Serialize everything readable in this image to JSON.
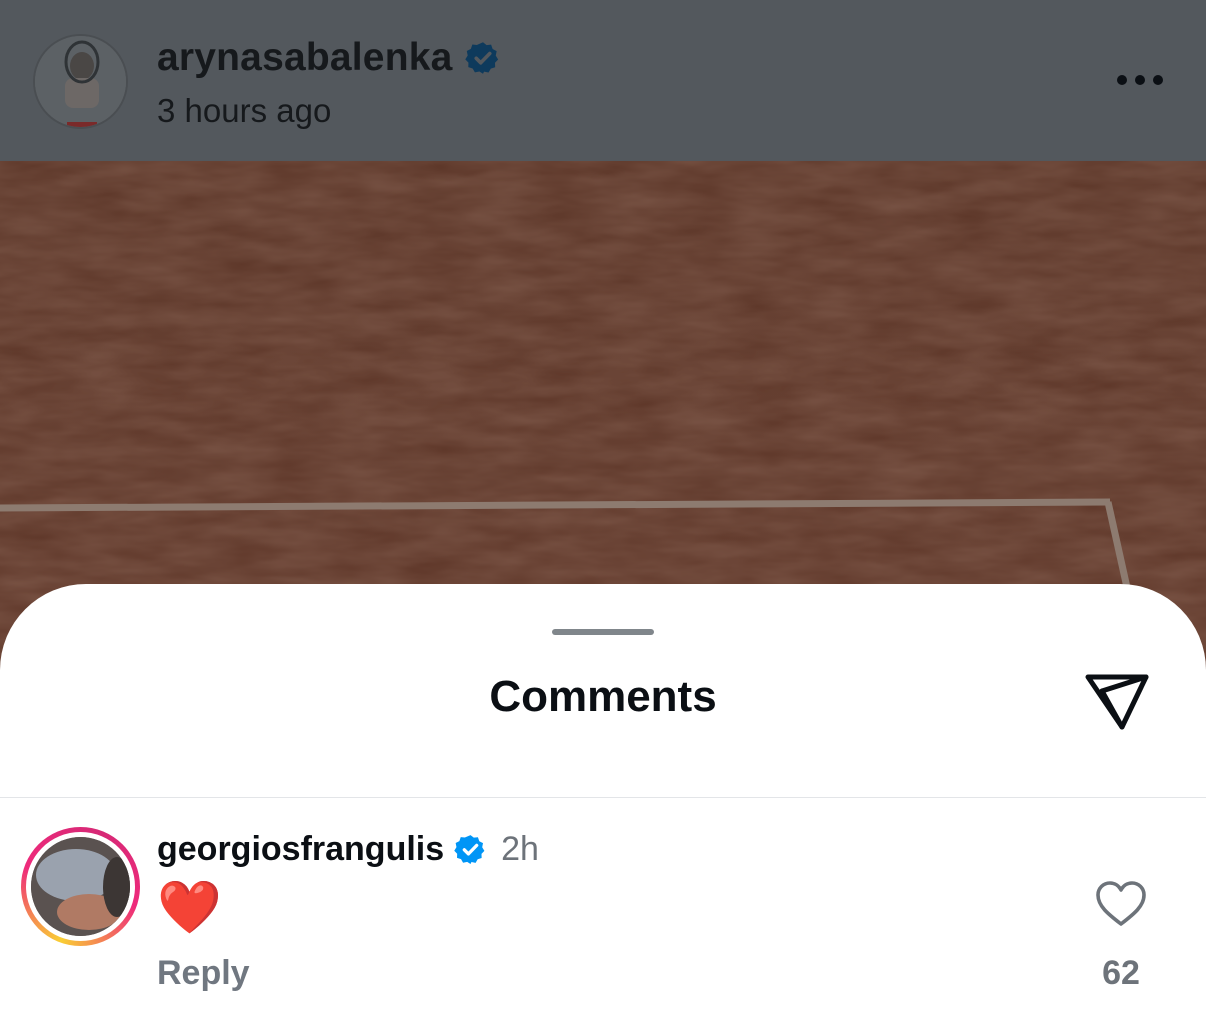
{
  "post": {
    "username": "arynasabalenka",
    "verified_icon": "verified-badge-icon",
    "time": "3 hours ago",
    "more_icon": "more-options-icon"
  },
  "comments_sheet": {
    "title": "Comments",
    "share_icon": "send-icon"
  },
  "comment": {
    "username": "georgiosfrangulis",
    "verified_icon": "verified-badge-icon",
    "time": "2h",
    "text": "❤️",
    "reply_label": "Reply",
    "like_icon": "heart-outline-icon",
    "like_count": "62"
  },
  "colors": {
    "verified_blue": "#0095f6",
    "court_clay": "#5a3526",
    "overlay_header": "#53585d",
    "story_ring": [
      "#f9ce34",
      "#ee2a7b"
    ]
  }
}
